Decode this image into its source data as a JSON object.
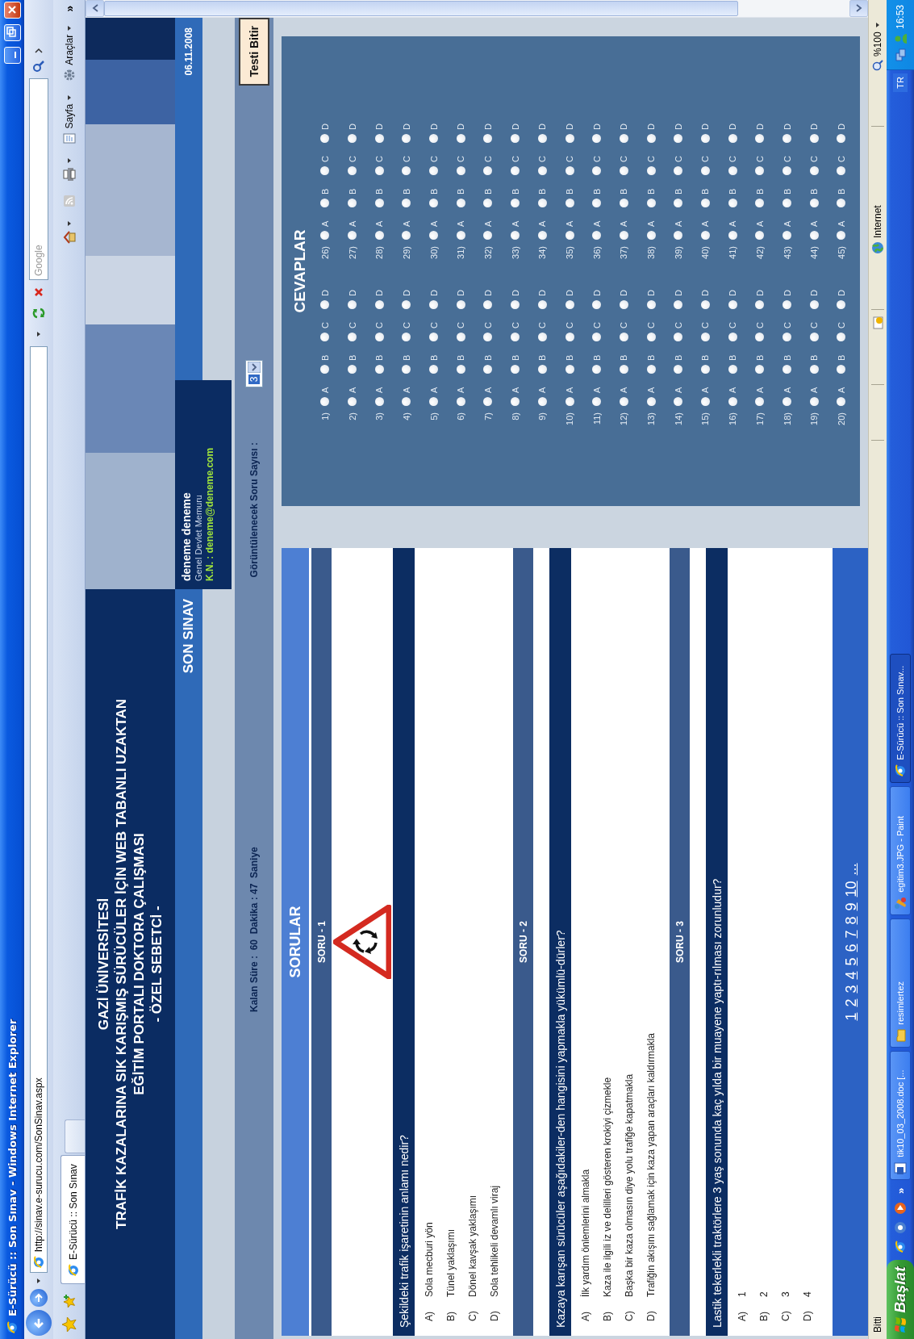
{
  "window": {
    "title": "E-Sürücü :: Son Sınav - Windows Internet Explorer"
  },
  "address_bar": {
    "url": "http://sinav.e-surucu.com/SonSinav.aspx"
  },
  "search": {
    "placeholder": "Google"
  },
  "tabs": [
    {
      "label": "E-Sürücü :: Son Sınav",
      "selected": true
    }
  ],
  "command_bar": {
    "menus": [
      {
        "label": "Sayfa",
        "kind": "page"
      },
      {
        "label": "Araçlar",
        "kind": "tools"
      }
    ],
    "overflow": "»"
  },
  "header": {
    "lines": [
      "GAZİ ÜNİVERSİTESİ",
      "TRAFİK KAZALARINA SIK KARIŞMIŞ SÜRÜCÜLER İÇİN WEB TABANLI UZAKTAN",
      "EĞİTİM PORTALI DOKTORA ÇALIŞMASI",
      "- ÖZEL SEBETCİ -"
    ]
  },
  "section_title": "SON SINAV",
  "user": {
    "name": "deneme deneme",
    "role": "Genel Devlet Memuru",
    "login": "K.N. : deneme@deneme.com"
  },
  "date": "06.11.2008",
  "timer": "Kalan Süre :  60  Dakika : 47  Saniye",
  "question_count": {
    "label": "Görüntülenecek Soru Sayısı :",
    "value": "3"
  },
  "finish_button": "Testi Bitir",
  "questions_panel": {
    "title": "SORULAR",
    "questions": [
      {
        "number": "SORU - 1",
        "kind": "image",
        "text": "Şekildeki trafik işaretinin anlamı nedir?",
        "options": [
          {
            "letter": "A)",
            "text": "Sola mecburi yön"
          },
          {
            "letter": "B)",
            "text": "Tünel yaklaşımı"
          },
          {
            "letter": "C)",
            "text": "Dönel kavşak yaklaşımı"
          },
          {
            "letter": "D)",
            "text": "Sola tehlikeli devamlı viraj"
          }
        ]
      },
      {
        "number": "SORU - 2",
        "kind": "text",
        "text": "Kazaya karışan sürücüler aşağıdakiler-den hangisini yapmakla yükümlü-dürler?",
        "options": [
          {
            "letter": "A)",
            "text": "İlk yardım önlemlerini almakla"
          },
          {
            "letter": "B)",
            "text": "Kaza ile ilgili iz ve delilleri gösteren krokiyi çizmekle"
          },
          {
            "letter": "C)",
            "text": "Başka bir kaza olmasın diye yolu trafiğe kapatmakla"
          },
          {
            "letter": "D)",
            "text": "Trafiğin akışını sağlamak için kaza yapan araçları kaldırmakla"
          }
        ]
      },
      {
        "number": "SORU - 3",
        "kind": "text",
        "text": "Lastik tekerlekli traktörlere 3 yaş sonunda kaç yılda bir muayene yaptı-rılması zorunludur?",
        "options": [
          {
            "letter": "A)",
            "text": "1"
          },
          {
            "letter": "B)",
            "text": "2"
          },
          {
            "letter": "C)",
            "text": "3"
          },
          {
            "letter": "D)",
            "text": "4"
          }
        ]
      }
    ],
    "pages": [
      "1",
      "2",
      "3",
      "4",
      "5",
      "6",
      "7",
      "8",
      "9",
      "10",
      "..."
    ]
  },
  "answers_panel": {
    "title": "CEVAPLAR",
    "columns": [
      {
        "rows": [
          {
            "number": "1)",
            "options": [
              {
                "label": "A",
                "selected": false
              },
              {
                "label": "B",
                "selected": false
              },
              {
                "label": "C",
                "selected": false
              },
              {
                "label": "D",
                "selected": false
              }
            ]
          },
          {
            "number": "2)",
            "options": [
              {
                "label": "A",
                "selected": false
              },
              {
                "label": "B",
                "selected": false
              },
              {
                "label": "C",
                "selected": false
              },
              {
                "label": "D",
                "selected": false
              }
            ]
          },
          {
            "number": "3)",
            "options": [
              {
                "label": "A",
                "selected": false
              },
              {
                "label": "B",
                "selected": false
              },
              {
                "label": "C",
                "selected": false
              },
              {
                "label": "D",
                "selected": false
              }
            ]
          },
          {
            "number": "4)",
            "options": [
              {
                "label": "A",
                "selected": false
              },
              {
                "label": "B",
                "selected": false
              },
              {
                "label": "C",
                "selected": false
              },
              {
                "label": "D",
                "selected": false
              }
            ]
          },
          {
            "number": "5)",
            "options": [
              {
                "label": "A",
                "selected": false
              },
              {
                "label": "B",
                "selected": false
              },
              {
                "label": "C",
                "selected": false
              },
              {
                "label": "D",
                "selected": false
              }
            ]
          },
          {
            "number": "6)",
            "options": [
              {
                "label": "A",
                "selected": false
              },
              {
                "label": "B",
                "selected": false
              },
              {
                "label": "C",
                "selected": false
              },
              {
                "label": "D",
                "selected": false
              }
            ]
          },
          {
            "number": "7)",
            "options": [
              {
                "label": "A",
                "selected": false
              },
              {
                "label": "B",
                "selected": false
              },
              {
                "label": "C",
                "selected": false
              },
              {
                "label": "D",
                "selected": false
              }
            ]
          },
          {
            "number": "8)",
            "options": [
              {
                "label": "A",
                "selected": false
              },
              {
                "label": "B",
                "selected": false
              },
              {
                "label": "C",
                "selected": false
              },
              {
                "label": "D",
                "selected": false
              }
            ]
          },
          {
            "number": "9)",
            "options": [
              {
                "label": "A",
                "selected": false
              },
              {
                "label": "B",
                "selected": false
              },
              {
                "label": "C",
                "selected": false
              },
              {
                "label": "D",
                "selected": false
              }
            ]
          },
          {
            "number": "10)",
            "options": [
              {
                "label": "A",
                "selected": false
              },
              {
                "label": "B",
                "selected": false
              },
              {
                "label": "C",
                "selected": false
              },
              {
                "label": "D",
                "selected": false
              }
            ]
          },
          {
            "number": "11)",
            "options": [
              {
                "label": "A",
                "selected": false
              },
              {
                "label": "B",
                "selected": false
              },
              {
                "label": "C",
                "selected": false
              },
              {
                "label": "D",
                "selected": false
              }
            ]
          },
          {
            "number": "12)",
            "options": [
              {
                "label": "A",
                "selected": false
              },
              {
                "label": "B",
                "selected": false
              },
              {
                "label": "C",
                "selected": false
              },
              {
                "label": "D",
                "selected": false
              }
            ]
          },
          {
            "number": "13)",
            "options": [
              {
                "label": "A",
                "selected": false
              },
              {
                "label": "B",
                "selected": false
              },
              {
                "label": "C",
                "selected": false
              },
              {
                "label": "D",
                "selected": false
              }
            ]
          },
          {
            "number": "14)",
            "options": [
              {
                "label": "A",
                "selected": false
              },
              {
                "label": "B",
                "selected": false
              },
              {
                "label": "C",
                "selected": false
              },
              {
                "label": "D",
                "selected": false
              }
            ]
          },
          {
            "number": "15)",
            "options": [
              {
                "label": "A",
                "selected": false
              },
              {
                "label": "B",
                "selected": false
              },
              {
                "label": "C",
                "selected": false
              },
              {
                "label": "D",
                "selected": false
              }
            ]
          },
          {
            "number": "16)",
            "options": [
              {
                "label": "A",
                "selected": false
              },
              {
                "label": "B",
                "selected": false
              },
              {
                "label": "C",
                "selected": false
              },
              {
                "label": "D",
                "selected": false
              }
            ]
          },
          {
            "number": "17)",
            "options": [
              {
                "label": "A",
                "selected": false
              },
              {
                "label": "B",
                "selected": false
              },
              {
                "label": "C",
                "selected": false
              },
              {
                "label": "D",
                "selected": false
              }
            ]
          },
          {
            "number": "18)",
            "options": [
              {
                "label": "A",
                "selected": false
              },
              {
                "label": "B",
                "selected": false
              },
              {
                "label": "C",
                "selected": false
              },
              {
                "label": "D",
                "selected": false
              }
            ]
          },
          {
            "number": "19)",
            "options": [
              {
                "label": "A",
                "selected": false
              },
              {
                "label": "B",
                "selected": false
              },
              {
                "label": "C",
                "selected": false
              },
              {
                "label": "D",
                "selected": false
              }
            ]
          },
          {
            "number": "20)",
            "options": [
              {
                "label": "A",
                "selected": false
              },
              {
                "label": "B",
                "selected": false
              },
              {
                "label": "C",
                "selected": false
              },
              {
                "label": "D",
                "selected": false
              }
            ]
          }
        ]
      },
      {
        "rows": [
          {
            "number": "26)",
            "options": [
              {
                "label": "A",
                "selected": false
              },
              {
                "label": "B",
                "selected": false
              },
              {
                "label": "C",
                "selected": false
              },
              {
                "label": "D",
                "selected": false
              }
            ]
          },
          {
            "number": "27)",
            "options": [
              {
                "label": "A",
                "selected": false
              },
              {
                "label": "B",
                "selected": false
              },
              {
                "label": "C",
                "selected": false
              },
              {
                "label": "D",
                "selected": false
              }
            ]
          },
          {
            "number": "28)",
            "options": [
              {
                "label": "A",
                "selected": false
              },
              {
                "label": "B",
                "selected": false
              },
              {
                "label": "C",
                "selected": false
              },
              {
                "label": "D",
                "selected": false
              }
            ]
          },
          {
            "number": "29)",
            "options": [
              {
                "label": "A",
                "selected": false
              },
              {
                "label": "B",
                "selected": false
              },
              {
                "label": "C",
                "selected": false
              },
              {
                "label": "D",
                "selected": false
              }
            ]
          },
          {
            "number": "30)",
            "options": [
              {
                "label": "A",
                "selected": false
              },
              {
                "label": "B",
                "selected": false
              },
              {
                "label": "C",
                "selected": false
              },
              {
                "label": "D",
                "selected": false
              }
            ]
          },
          {
            "number": "31)",
            "options": [
              {
                "label": "A",
                "selected": false
              },
              {
                "label": "B",
                "selected": false
              },
              {
                "label": "C",
                "selected": false
              },
              {
                "label": "D",
                "selected": false
              }
            ]
          },
          {
            "number": "32)",
            "options": [
              {
                "label": "A",
                "selected": false
              },
              {
                "label": "B",
                "selected": false
              },
              {
                "label": "C",
                "selected": false
              },
              {
                "label": "D",
                "selected": false
              }
            ]
          },
          {
            "number": "33)",
            "options": [
              {
                "label": "A",
                "selected": false
              },
              {
                "label": "B",
                "selected": false
              },
              {
                "label": "C",
                "selected": false
              },
              {
                "label": "D",
                "selected": false
              }
            ]
          },
          {
            "number": "34)",
            "options": [
              {
                "label": "A",
                "selected": false
              },
              {
                "label": "B",
                "selected": false
              },
              {
                "label": "C",
                "selected": false
              },
              {
                "label": "D",
                "selected": false
              }
            ]
          },
          {
            "number": "35)",
            "options": [
              {
                "label": "A",
                "selected": false
              },
              {
                "label": "B",
                "selected": false
              },
              {
                "label": "C",
                "selected": false
              },
              {
                "label": "D",
                "selected": false
              }
            ]
          },
          {
            "number": "36)",
            "options": [
              {
                "label": "A",
                "selected": false
              },
              {
                "label": "B",
                "selected": false
              },
              {
                "label": "C",
                "selected": false
              },
              {
                "label": "D",
                "selected": false
              }
            ]
          },
          {
            "number": "37)",
            "options": [
              {
                "label": "A",
                "selected": false
              },
              {
                "label": "B",
                "selected": false
              },
              {
                "label": "C",
                "selected": false
              },
              {
                "label": "D",
                "selected": false
              }
            ]
          },
          {
            "number": "38)",
            "options": [
              {
                "label": "A",
                "selected": false
              },
              {
                "label": "B",
                "selected": false
              },
              {
                "label": "C",
                "selected": false
              },
              {
                "label": "D",
                "selected": false
              }
            ]
          },
          {
            "number": "39)",
            "options": [
              {
                "label": "A",
                "selected": false
              },
              {
                "label": "B",
                "selected": false
              },
              {
                "label": "C",
                "selected": false
              },
              {
                "label": "D",
                "selected": false
              }
            ]
          },
          {
            "number": "40)",
            "options": [
              {
                "label": "A",
                "selected": false
              },
              {
                "label": "B",
                "selected": false
              },
              {
                "label": "C",
                "selected": false
              },
              {
                "label": "D",
                "selected": false
              }
            ]
          },
          {
            "number": "41)",
            "options": [
              {
                "label": "A",
                "selected": false
              },
              {
                "label": "B",
                "selected": false
              },
              {
                "label": "C",
                "selected": false
              },
              {
                "label": "D",
                "selected": false
              }
            ]
          },
          {
            "number": "42)",
            "options": [
              {
                "label": "A",
                "selected": false
              },
              {
                "label": "B",
                "selected": false
              },
              {
                "label": "C",
                "selected": false
              },
              {
                "label": "D",
                "selected": false
              }
            ]
          },
          {
            "number": "43)",
            "options": [
              {
                "label": "A",
                "selected": false
              },
              {
                "label": "B",
                "selected": false
              },
              {
                "label": "C",
                "selected": false
              },
              {
                "label": "D",
                "selected": false
              }
            ]
          },
          {
            "number": "44)",
            "options": [
              {
                "label": "A",
                "selected": false
              },
              {
                "label": "B",
                "selected": false
              },
              {
                "label": "C",
                "selected": false
              },
              {
                "label": "D",
                "selected": false
              }
            ]
          },
          {
            "number": "45)",
            "options": [
              {
                "label": "A",
                "selected": false
              },
              {
                "label": "B",
                "selected": false
              },
              {
                "label": "C",
                "selected": false
              },
              {
                "label": "D",
                "selected": false
              }
            ]
          }
        ]
      }
    ]
  },
  "status_bar": {
    "text": "Bitti",
    "zone": "Internet",
    "zoom": "%100"
  },
  "taskbar": {
    "start": "Başlat",
    "overflow": "»",
    "tasks": [
      {
        "label": "tik10_03_2008.doc [...",
        "kind": "document",
        "selected": false
      },
      {
        "label": "resimlertez",
        "kind": "folder",
        "selected": false
      },
      {
        "label": "egitim3.JPG - Paint",
        "kind": "paint",
        "selected": false
      },
      {
        "label": "E-Sürücü :: Son Sınav...",
        "kind": "browser",
        "selected": true
      }
    ],
    "language": "TR",
    "clock": "16:53"
  }
}
